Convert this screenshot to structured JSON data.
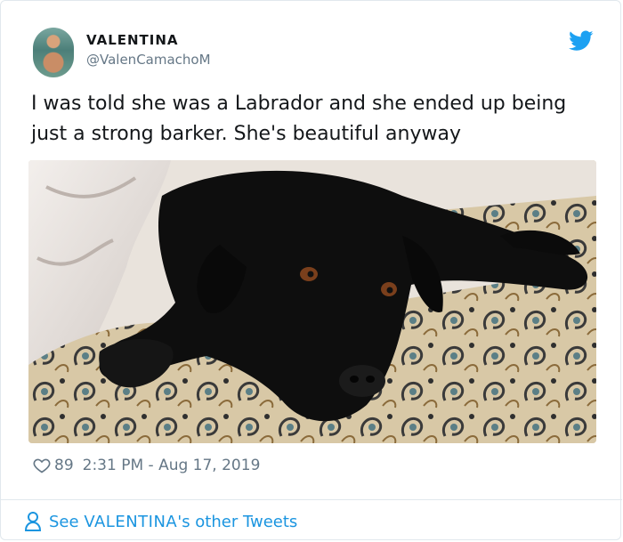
{
  "tweet": {
    "author_name": "VALENTINA",
    "author_handle": "@ValenCamachoM",
    "text": "I was told she was a Labrador and she ended up being just a strong barker. She's beautiful anyway",
    "likes": "89",
    "timestamp": "2:31 PM - Aug 17, 2019"
  },
  "footer": {
    "prefix": "See ",
    "name": "VALENTINA",
    "suffix": "'s other Tweets"
  },
  "icons": {
    "brand": "twitter-bird-icon",
    "like": "heart-icon",
    "profile": "person-icon"
  },
  "colors": {
    "accent": "#1da1f2",
    "link": "#1b95e0",
    "muted": "#657786",
    "text": "#14171a"
  }
}
